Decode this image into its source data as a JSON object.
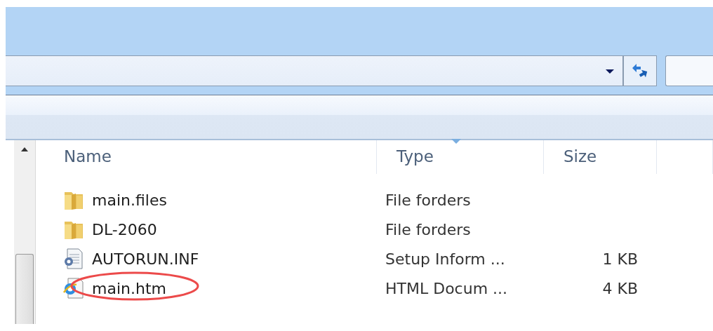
{
  "columns": [
    {
      "label": "Name",
      "sorted": false
    },
    {
      "label": "Type",
      "sorted": true
    },
    {
      "label": "Size",
      "sorted": false
    }
  ],
  "rows": [
    {
      "name": "main.files",
      "kind": "folder",
      "type": "File forders",
      "size": "",
      "circled": false
    },
    {
      "name": "DL-2060",
      "kind": "folder",
      "type": "File forders",
      "size": "",
      "circled": false
    },
    {
      "name": "AUTORUN.INF",
      "kind": "settings",
      "type": "Setup Inform ...",
      "size": "1 KB",
      "circled": false
    },
    {
      "name": "main.htm",
      "kind": "html",
      "type": "HTML Docum ...",
      "size": "4 KB",
      "circled": true
    }
  ]
}
